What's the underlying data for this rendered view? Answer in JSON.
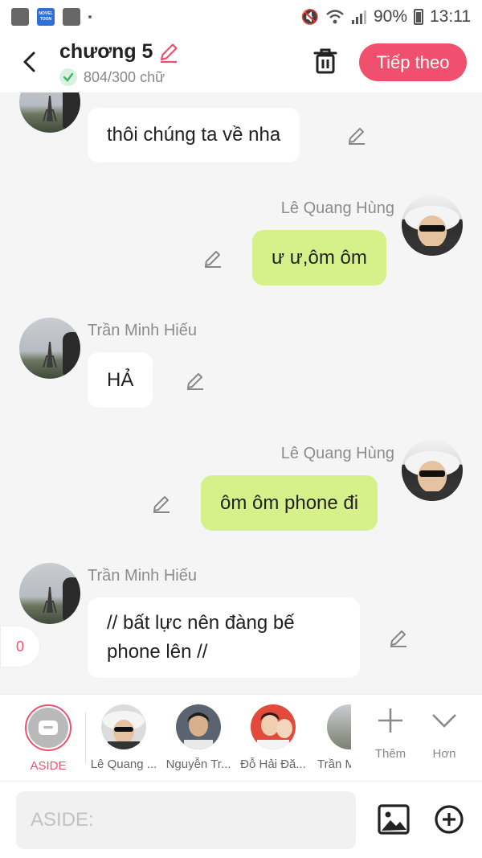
{
  "status_bar": {
    "battery": "90%",
    "time": "13:11",
    "novel_icon_text": "NOVEL TOON"
  },
  "header": {
    "title": "chương 5",
    "word_count": "804/300 chữ",
    "next_label": "Tiếp theo"
  },
  "messages": [
    {
      "side": "left",
      "name": "",
      "text": "thôi chúng ta về nha"
    },
    {
      "side": "right",
      "name": "Lê Quang Hùng",
      "text": "ư ư,ôm ôm"
    },
    {
      "side": "left",
      "name": "Trần Minh Hiếu",
      "text": "HẢ"
    },
    {
      "side": "right",
      "name": "Lê Quang Hùng",
      "text": "ôm ôm phone đi"
    },
    {
      "side": "left",
      "name": "Trần Minh Hiếu",
      "text": "// bất lực nên đàng bế phone lên //"
    }
  ],
  "counter": "0",
  "characters": {
    "aside_label": "ASIDE",
    "items": [
      {
        "label": "Lê Quang ..."
      },
      {
        "label": "Nguyễn Tr..."
      },
      {
        "label": "Đỗ Hải Đă..."
      },
      {
        "label": "Trần M"
      }
    ],
    "more_label": "Thêm",
    "collapse_label": "Hơn"
  },
  "input": {
    "placeholder": "ASIDE:"
  },
  "colors": {
    "accent": "#f0506e",
    "bubble_green": "#d6f08a",
    "bubble_white": "#ffffff",
    "check_green": "#3cb563"
  }
}
